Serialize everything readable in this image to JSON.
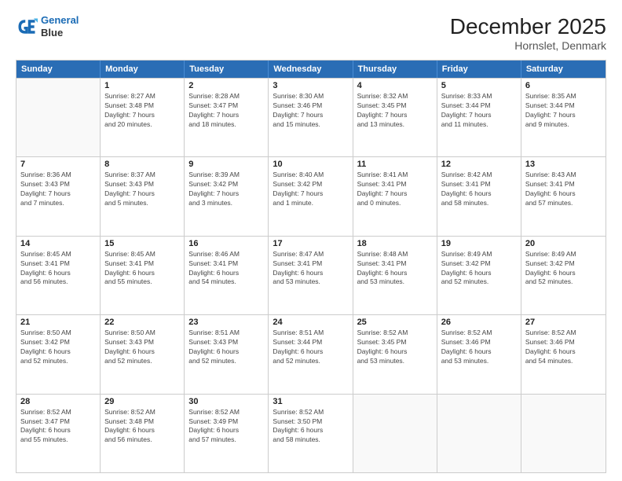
{
  "header": {
    "logo_line1": "General",
    "logo_line2": "Blue",
    "main_title": "December 2025",
    "sub_title": "Hornslet, Denmark"
  },
  "days_of_week": [
    "Sunday",
    "Monday",
    "Tuesday",
    "Wednesday",
    "Thursday",
    "Friday",
    "Saturday"
  ],
  "rows": [
    [
      {
        "day": "",
        "info": [],
        "empty": true
      },
      {
        "day": "1",
        "info": [
          "Sunrise: 8:27 AM",
          "Sunset: 3:48 PM",
          "Daylight: 7 hours",
          "and 20 minutes."
        ],
        "empty": false
      },
      {
        "day": "2",
        "info": [
          "Sunrise: 8:28 AM",
          "Sunset: 3:47 PM",
          "Daylight: 7 hours",
          "and 18 minutes."
        ],
        "empty": false
      },
      {
        "day": "3",
        "info": [
          "Sunrise: 8:30 AM",
          "Sunset: 3:46 PM",
          "Daylight: 7 hours",
          "and 15 minutes."
        ],
        "empty": false
      },
      {
        "day": "4",
        "info": [
          "Sunrise: 8:32 AM",
          "Sunset: 3:45 PM",
          "Daylight: 7 hours",
          "and 13 minutes."
        ],
        "empty": false
      },
      {
        "day": "5",
        "info": [
          "Sunrise: 8:33 AM",
          "Sunset: 3:44 PM",
          "Daylight: 7 hours",
          "and 11 minutes."
        ],
        "empty": false
      },
      {
        "day": "6",
        "info": [
          "Sunrise: 8:35 AM",
          "Sunset: 3:44 PM",
          "Daylight: 7 hours",
          "and 9 minutes."
        ],
        "empty": false
      }
    ],
    [
      {
        "day": "7",
        "info": [
          "Sunrise: 8:36 AM",
          "Sunset: 3:43 PM",
          "Daylight: 7 hours",
          "and 7 minutes."
        ],
        "empty": false
      },
      {
        "day": "8",
        "info": [
          "Sunrise: 8:37 AM",
          "Sunset: 3:43 PM",
          "Daylight: 7 hours",
          "and 5 minutes."
        ],
        "empty": false
      },
      {
        "day": "9",
        "info": [
          "Sunrise: 8:39 AM",
          "Sunset: 3:42 PM",
          "Daylight: 7 hours",
          "and 3 minutes."
        ],
        "empty": false
      },
      {
        "day": "10",
        "info": [
          "Sunrise: 8:40 AM",
          "Sunset: 3:42 PM",
          "Daylight: 7 hours",
          "and 1 minute."
        ],
        "empty": false
      },
      {
        "day": "11",
        "info": [
          "Sunrise: 8:41 AM",
          "Sunset: 3:41 PM",
          "Daylight: 7 hours",
          "and 0 minutes."
        ],
        "empty": false
      },
      {
        "day": "12",
        "info": [
          "Sunrise: 8:42 AM",
          "Sunset: 3:41 PM",
          "Daylight: 6 hours",
          "and 58 minutes."
        ],
        "empty": false
      },
      {
        "day": "13",
        "info": [
          "Sunrise: 8:43 AM",
          "Sunset: 3:41 PM",
          "Daylight: 6 hours",
          "and 57 minutes."
        ],
        "empty": false
      }
    ],
    [
      {
        "day": "14",
        "info": [
          "Sunrise: 8:45 AM",
          "Sunset: 3:41 PM",
          "Daylight: 6 hours",
          "and 56 minutes."
        ],
        "empty": false
      },
      {
        "day": "15",
        "info": [
          "Sunrise: 8:45 AM",
          "Sunset: 3:41 PM",
          "Daylight: 6 hours",
          "and 55 minutes."
        ],
        "empty": false
      },
      {
        "day": "16",
        "info": [
          "Sunrise: 8:46 AM",
          "Sunset: 3:41 PM",
          "Daylight: 6 hours",
          "and 54 minutes."
        ],
        "empty": false
      },
      {
        "day": "17",
        "info": [
          "Sunrise: 8:47 AM",
          "Sunset: 3:41 PM",
          "Daylight: 6 hours",
          "and 53 minutes."
        ],
        "empty": false
      },
      {
        "day": "18",
        "info": [
          "Sunrise: 8:48 AM",
          "Sunset: 3:41 PM",
          "Daylight: 6 hours",
          "and 53 minutes."
        ],
        "empty": false
      },
      {
        "day": "19",
        "info": [
          "Sunrise: 8:49 AM",
          "Sunset: 3:42 PM",
          "Daylight: 6 hours",
          "and 52 minutes."
        ],
        "empty": false
      },
      {
        "day": "20",
        "info": [
          "Sunrise: 8:49 AM",
          "Sunset: 3:42 PM",
          "Daylight: 6 hours",
          "and 52 minutes."
        ],
        "empty": false
      }
    ],
    [
      {
        "day": "21",
        "info": [
          "Sunrise: 8:50 AM",
          "Sunset: 3:42 PM",
          "Daylight: 6 hours",
          "and 52 minutes."
        ],
        "empty": false
      },
      {
        "day": "22",
        "info": [
          "Sunrise: 8:50 AM",
          "Sunset: 3:43 PM",
          "Daylight: 6 hours",
          "and 52 minutes."
        ],
        "empty": false
      },
      {
        "day": "23",
        "info": [
          "Sunrise: 8:51 AM",
          "Sunset: 3:43 PM",
          "Daylight: 6 hours",
          "and 52 minutes."
        ],
        "empty": false
      },
      {
        "day": "24",
        "info": [
          "Sunrise: 8:51 AM",
          "Sunset: 3:44 PM",
          "Daylight: 6 hours",
          "and 52 minutes."
        ],
        "empty": false
      },
      {
        "day": "25",
        "info": [
          "Sunrise: 8:52 AM",
          "Sunset: 3:45 PM",
          "Daylight: 6 hours",
          "and 53 minutes."
        ],
        "empty": false
      },
      {
        "day": "26",
        "info": [
          "Sunrise: 8:52 AM",
          "Sunset: 3:46 PM",
          "Daylight: 6 hours",
          "and 53 minutes."
        ],
        "empty": false
      },
      {
        "day": "27",
        "info": [
          "Sunrise: 8:52 AM",
          "Sunset: 3:46 PM",
          "Daylight: 6 hours",
          "and 54 minutes."
        ],
        "empty": false
      }
    ],
    [
      {
        "day": "28",
        "info": [
          "Sunrise: 8:52 AM",
          "Sunset: 3:47 PM",
          "Daylight: 6 hours",
          "and 55 minutes."
        ],
        "empty": false
      },
      {
        "day": "29",
        "info": [
          "Sunrise: 8:52 AM",
          "Sunset: 3:48 PM",
          "Daylight: 6 hours",
          "and 56 minutes."
        ],
        "empty": false
      },
      {
        "day": "30",
        "info": [
          "Sunrise: 8:52 AM",
          "Sunset: 3:49 PM",
          "Daylight: 6 hours",
          "and 57 minutes."
        ],
        "empty": false
      },
      {
        "day": "31",
        "info": [
          "Sunrise: 8:52 AM",
          "Sunset: 3:50 PM",
          "Daylight: 6 hours",
          "and 58 minutes."
        ],
        "empty": false
      },
      {
        "day": "",
        "info": [],
        "empty": true
      },
      {
        "day": "",
        "info": [],
        "empty": true
      },
      {
        "day": "",
        "info": [],
        "empty": true
      }
    ]
  ]
}
